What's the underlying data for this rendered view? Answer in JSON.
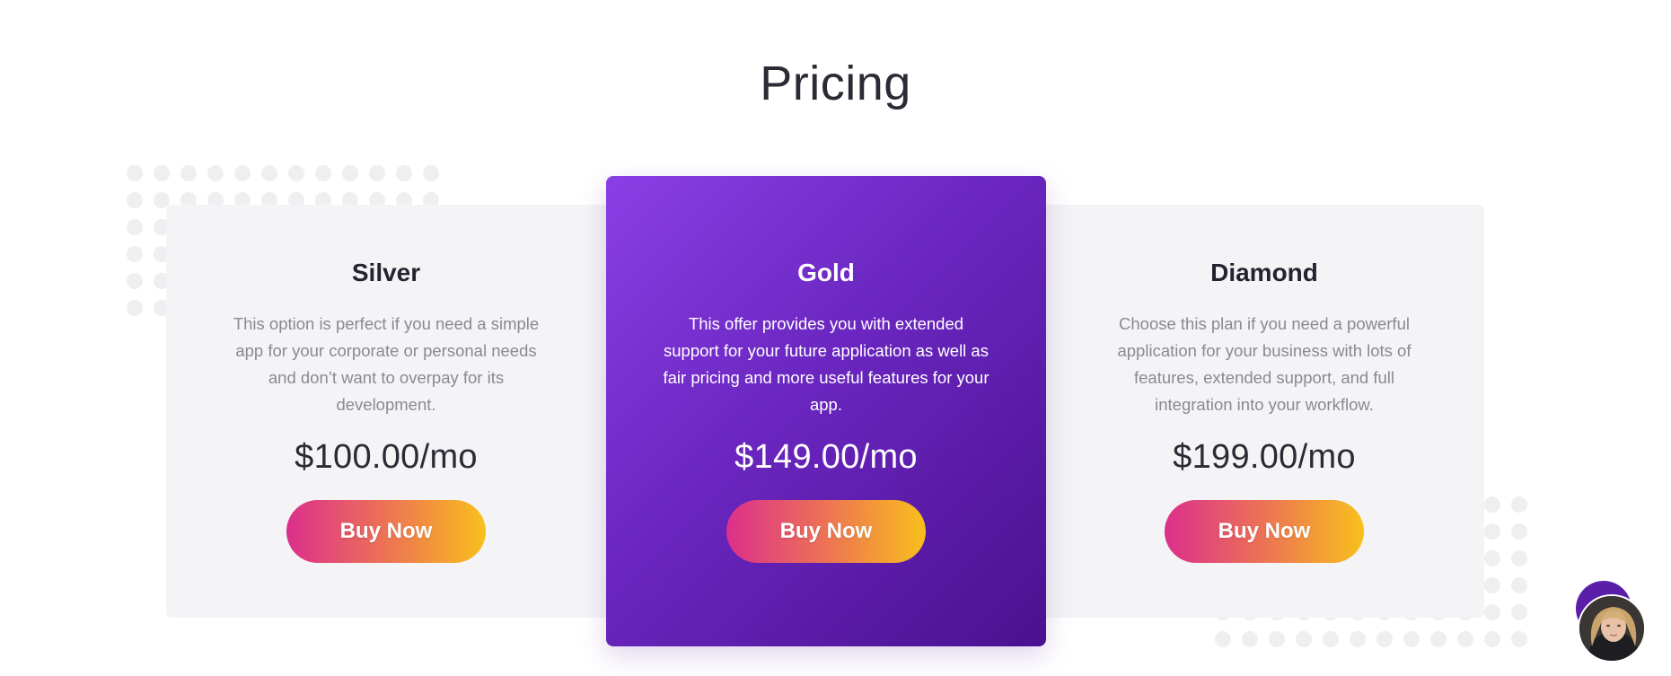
{
  "section": {
    "title": "Pricing"
  },
  "plans": [
    {
      "name": "Silver",
      "description": "This option is perfect if you need a simple app for your corporate or personal needs and don’t want to overpay for its development.",
      "price": "$100.00/mo",
      "button_label": "Buy Now"
    },
    {
      "name": "Gold",
      "description": "This offer provides you with extended support for your future application as well as fair pricing and more useful features for your app.",
      "price": "$149.00/mo",
      "button_label": "Buy Now"
    },
    {
      "name": "Diamond",
      "description": "Choose this plan if you need a powerful application for your business with lots of features, extended support, and full integration into your workflow.",
      "price": "$199.00/mo",
      "button_label": "Buy Now"
    }
  ],
  "chat": {
    "icon": "chat-avatar-icon"
  },
  "colors": {
    "featured_start": "#8a3fe6",
    "featured_end": "#4a1190",
    "button_start": "#dc2f8c",
    "button_end": "#f8c01c",
    "band_bg": "#f4f4f6"
  }
}
